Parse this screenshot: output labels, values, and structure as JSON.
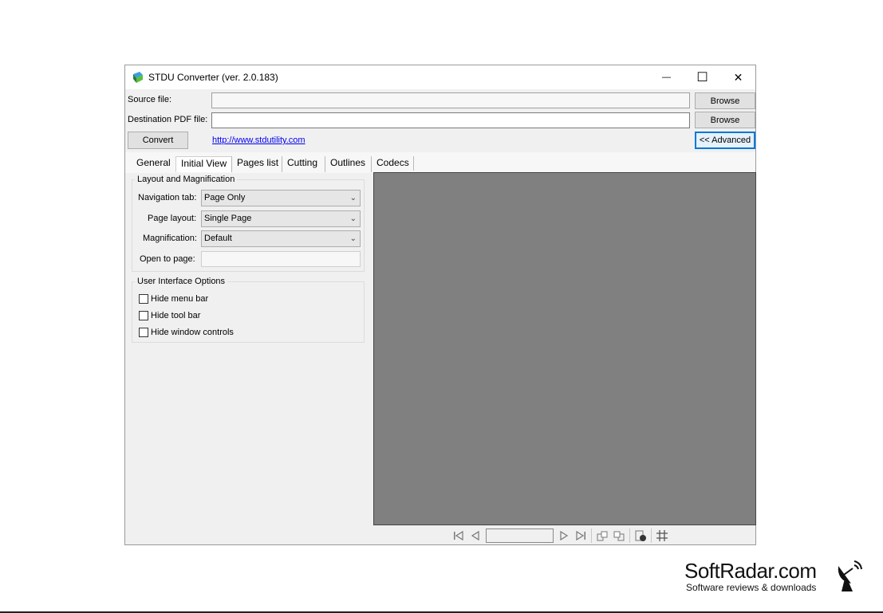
{
  "window": {
    "title": "STDU Converter (ver. 2.0.183)",
    "minimize_glyph": "—",
    "maximize_glyph": "☐",
    "close_glyph": "✕"
  },
  "form": {
    "source_label": "Source file:",
    "source_value": "",
    "dest_label": "Destination PDF file:",
    "dest_value": "",
    "browse_label": "Browse",
    "convert_label": "Convert",
    "link_text": "http://www.stdutility.com ",
    "advanced_label": "<< Advanced"
  },
  "tabs": [
    {
      "label": "General"
    },
    {
      "label": "Initial View"
    },
    {
      "label": "Pages list"
    },
    {
      "label": "Cutting"
    },
    {
      "label": "Outlines"
    },
    {
      "label": "Codecs"
    }
  ],
  "layout_group": {
    "title": "Layout and Magnification",
    "nav_label": "Navigation tab:",
    "nav_value": "Page Only",
    "page_layout_label": "Page layout:",
    "page_layout_value": "Single Page",
    "magnification_label": "Magnification:",
    "magnification_value": "Default",
    "open_page_label": "Open to page:",
    "open_page_value": ""
  },
  "ui_group": {
    "title": "User Interface Options",
    "options": [
      {
        "label": "Hide menu bar",
        "checked": false
      },
      {
        "label": "Hide tool bar",
        "checked": false
      },
      {
        "label": "Hide window controls",
        "checked": false
      }
    ]
  },
  "preview_toolbar": {
    "page_value": "",
    "icons": [
      "first-page-icon",
      "prev-page-icon",
      "next-page-icon",
      "last-page-icon",
      "rotate-left-icon",
      "rotate-right-icon",
      "contrast-icon",
      "grid-icon"
    ]
  },
  "watermark": {
    "brand": "SoftRadar.com",
    "tagline": "Software reviews & downloads"
  },
  "colors": {
    "preview_bg": "#808080",
    "link": "#0000ee",
    "focus_border": "#0078d7"
  }
}
